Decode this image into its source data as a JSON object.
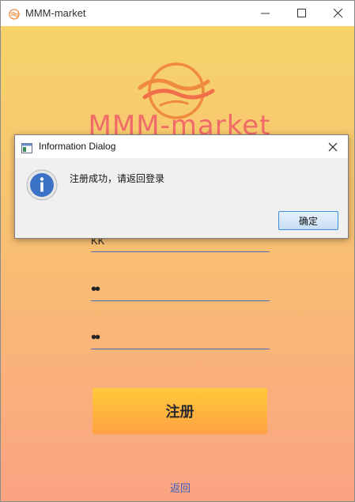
{
  "window": {
    "title": "MMM-market",
    "icons": {
      "app": "app-logo-icon",
      "minimize": "minimize-icon",
      "maximize": "maximize-icon",
      "close": "close-icon"
    }
  },
  "brand": {
    "name": "MMM-market",
    "logo_icon": "sun-waves-logo-icon",
    "colors": {
      "logo_orange": "#f08a3c",
      "brand_red": "#f16a6a"
    }
  },
  "form": {
    "username_value": "KK",
    "password_value": "••",
    "confirm_password_value": "••",
    "register_label": "注册",
    "back_label": "返回"
  },
  "dialog": {
    "title": "Information Dialog",
    "message": "注册成功，请返回登录",
    "ok_label": "确定",
    "icons": {
      "title": "dialog-window-icon",
      "info": "info-icon",
      "close": "close-icon"
    }
  },
  "colors": {
    "gradient_top": "#f6d46a",
    "gradient_bottom": "#fba383",
    "button_top": "#ffc93a",
    "button_bottom": "#ffa143",
    "link": "#3b5fc0",
    "input_underline": "#4a6fb0"
  }
}
